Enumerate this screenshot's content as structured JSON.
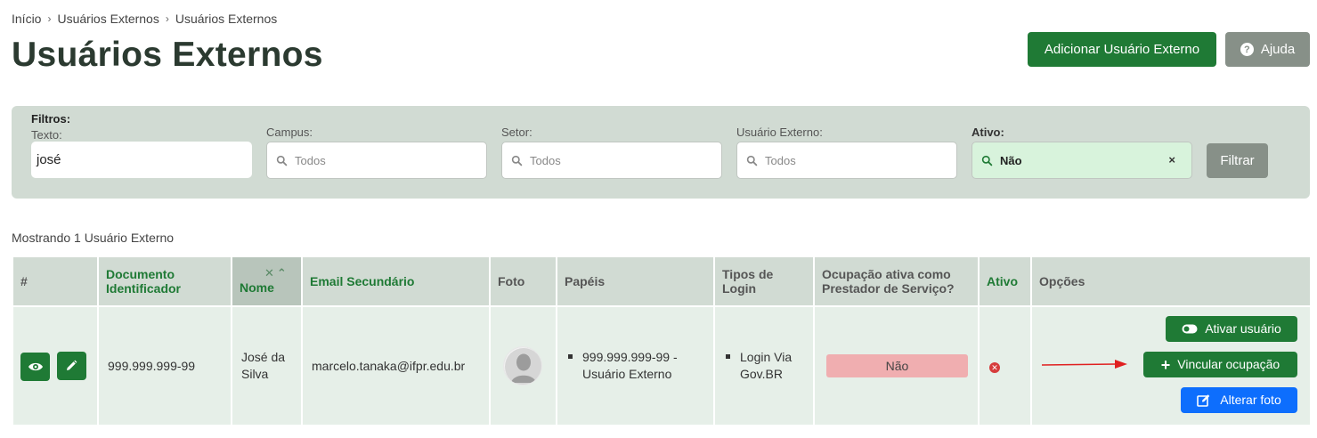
{
  "breadcrumb": {
    "items": [
      "Início",
      "Usuários Externos",
      "Usuários Externos"
    ]
  },
  "page": {
    "title": "Usuários Externos"
  },
  "header_buttons": {
    "add_label": "Adicionar Usuário Externo",
    "help_label": "Ajuda"
  },
  "filters": {
    "title": "Filtros:",
    "texto": {
      "label": "Texto:",
      "value": "josé"
    },
    "campus": {
      "label": "Campus:",
      "placeholder": "Todos"
    },
    "setor": {
      "label": "Setor:",
      "placeholder": "Todos"
    },
    "usuario_externo": {
      "label": "Usuário Externo:",
      "placeholder": "Todos"
    },
    "ativo": {
      "label": "Ativo:",
      "value": "Não",
      "clear": "×"
    },
    "submit_label": "Filtrar"
  },
  "results": {
    "count_text": "Mostrando 1 Usuário Externo"
  },
  "table": {
    "headers": {
      "hash": "#",
      "documento": "Documento Identificador",
      "nome": "Nome",
      "email": "Email Secundário",
      "foto": "Foto",
      "papeis": "Papéis",
      "tipos_login": "Tipos de Login",
      "ocupacao": "Ocupação ativa como Prestador de Serviço?",
      "ativo": "Ativo",
      "opcoes": "Opções"
    },
    "rows": [
      {
        "documento": "999.999.999-99",
        "nome": "José da Silva",
        "email": "marcelo.tanaka@ifpr.edu.br",
        "papeis": [
          "999.999.999-99 - Usuário Externo"
        ],
        "tipos_login": [
          "Login Via Gov.BR"
        ],
        "ocupacao": "Não",
        "ativo_icon": "x-circle-icon",
        "options": {
          "ativar_label": "Ativar usuário",
          "vincular_label": "Vincular ocupação",
          "alterar_foto_label": "Alterar foto"
        }
      }
    ]
  },
  "colors": {
    "primary_green": "#1f7a35",
    "muted_gray": "#879088",
    "filter_bg": "#d1dbd3",
    "cell_bg": "#e6efe8",
    "danger_pill": "#f0aeb0",
    "blue_button": "#0d6efd",
    "arrow_red": "#e02020"
  }
}
